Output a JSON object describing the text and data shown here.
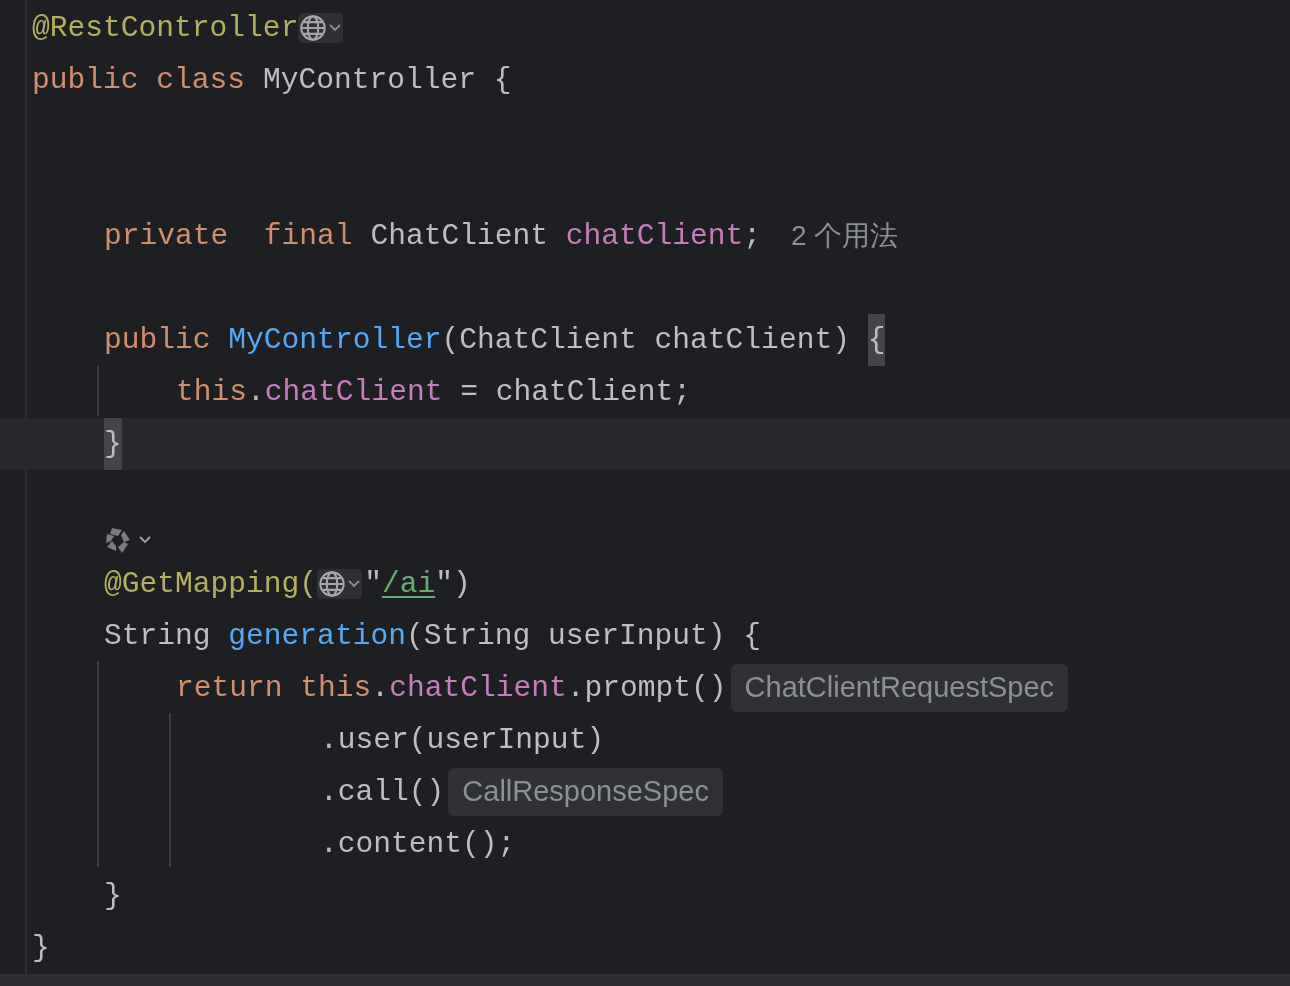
{
  "editor": {
    "lines": [
      {
        "tokens": [
          {
            "kind": "annotation",
            "text": "@RestController"
          },
          {
            "kind": "globe-widget"
          }
        ]
      },
      {
        "tokens": [
          {
            "kind": "keyword",
            "text": "public class "
          },
          {
            "kind": "plain",
            "text": "MyController {"
          }
        ],
        "children": [
          {
            "kind": "blank"
          },
          {
            "kind": "blank"
          },
          {
            "tokens": [
              {
                "kind": "keyword",
                "text": "private  final "
              },
              {
                "kind": "plain",
                "text": "ChatClient "
              },
              {
                "kind": "field",
                "text": "chatClient"
              },
              {
                "kind": "plain",
                "text": ";"
              },
              {
                "kind": "usage-hint",
                "text": "2 个用法"
              }
            ]
          },
          {
            "kind": "blank"
          },
          {
            "tokens": [
              {
                "kind": "keyword",
                "text": "public "
              },
              {
                "kind": "method",
                "text": "MyController"
              },
              {
                "kind": "plain",
                "text": "(ChatClient chatClient) "
              },
              {
                "kind": "brace-match",
                "text": "{"
              }
            ],
            "children": [
              {
                "tokens": [
                  {
                    "kind": "keyword",
                    "text": "this"
                  },
                  {
                    "kind": "plain",
                    "text": "."
                  },
                  {
                    "kind": "field",
                    "text": "chatClient"
                  },
                  {
                    "kind": "plain",
                    "text": " = chatClient;"
                  }
                ]
              }
            ]
          },
          {
            "current": true,
            "tokens": [
              {
                "kind": "brace-match",
                "text": "}"
              }
            ]
          },
          {
            "kind": "blank"
          },
          {
            "kind": "icon-row",
            "tokens": [
              {
                "kind": "bean-widget"
              }
            ]
          },
          {
            "tokens": [
              {
                "kind": "annotation",
                "text": "@GetMapping("
              },
              {
                "kind": "globe-widget"
              },
              {
                "kind": "plain",
                "text": "\""
              },
              {
                "kind": "url",
                "text": "/ai"
              },
              {
                "kind": "plain",
                "text": "\")"
              }
            ]
          },
          {
            "tokens": [
              {
                "kind": "plain",
                "text": "String "
              },
              {
                "kind": "method",
                "text": "generation"
              },
              {
                "kind": "plain",
                "text": "(String userInput) {"
              }
            ],
            "children": [
              {
                "tokens": [
                  {
                    "kind": "keyword",
                    "text": "return this"
                  },
                  {
                    "kind": "plain",
                    "text": "."
                  },
                  {
                    "kind": "field",
                    "text": "chatClient"
                  },
                  {
                    "kind": "plain",
                    "text": ".prompt()"
                  },
                  {
                    "kind": "type-hint",
                    "text": "ChatClientRequestSpec"
                  }
                ],
                "children": [
                  {
                    "kind": "continuation",
                    "tokens": [
                      {
                        "kind": "plain",
                        "text": ".user(userInput)"
                      }
                    ]
                  },
                  {
                    "kind": "continuation",
                    "tokens": [
                      {
                        "kind": "plain",
                        "text": ".call()"
                      },
                      {
                        "kind": "type-hint",
                        "text": "CallResponseSpec"
                      }
                    ]
                  },
                  {
                    "kind": "continuation",
                    "tokens": [
                      {
                        "kind": "plain",
                        "text": ".content();"
                      }
                    ]
                  }
                ]
              }
            ]
          },
          {
            "tokens": [
              {
                "kind": "plain",
                "text": "}"
              }
            ]
          }
        ]
      },
      {
        "tokens": [
          {
            "kind": "plain",
            "text": "}"
          }
        ]
      }
    ]
  }
}
